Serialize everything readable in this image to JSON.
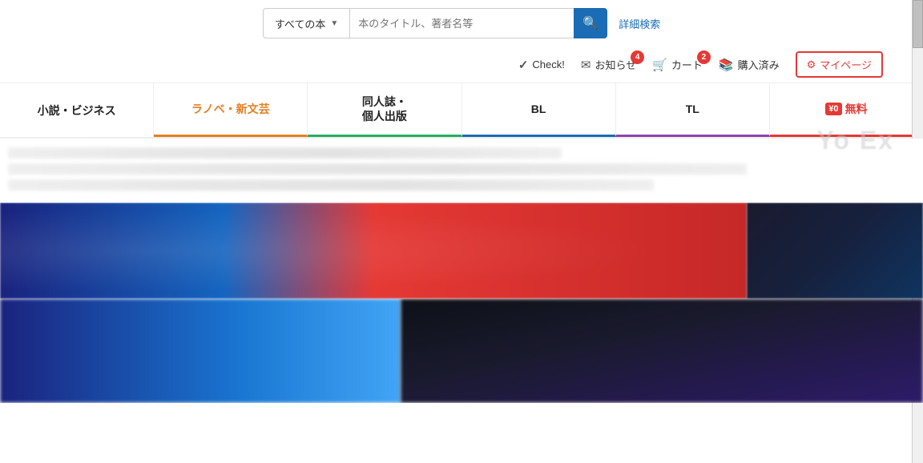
{
  "search": {
    "category_label": "すべての本",
    "placeholder": "本のタイトル、著者名等",
    "advanced_label": "詳細検索",
    "search_icon": "🔍"
  },
  "nav": {
    "check_label": "Check!",
    "notification_label": "お知らせ",
    "notification_badge": "4",
    "cart_label": "カート",
    "cart_badge": "2",
    "purchased_label": "購入済み",
    "mypage_label": "マイページ"
  },
  "categories": [
    {
      "id": "novels",
      "label": "小説・ビジネス",
      "style": "default"
    },
    {
      "id": "lightnovel",
      "label": "ラノベ・新文芸",
      "style": "orange"
    },
    {
      "id": "doujin",
      "label": "同人誌・\n個人出版",
      "style": "green"
    },
    {
      "id": "bl",
      "label": "BL",
      "style": "blue"
    },
    {
      "id": "tl",
      "label": "TL",
      "style": "purple"
    },
    {
      "id": "free",
      "label": "無料",
      "style": "red",
      "has_yen": true,
      "yen_label": "¥0"
    }
  ],
  "overlay": {
    "text": "Yo Ex"
  }
}
